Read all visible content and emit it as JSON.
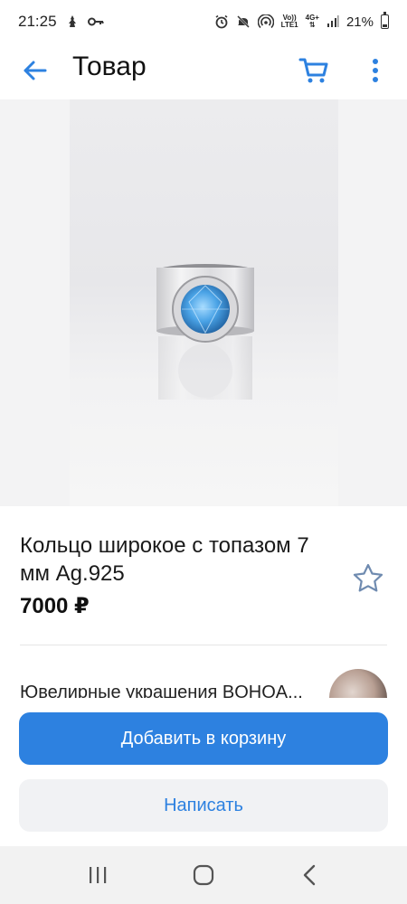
{
  "status_bar": {
    "time": "21:25",
    "battery_percent": "21%",
    "battery_level": 0.21,
    "network_top": "4G+",
    "network_bottom": "LTE1",
    "volte": "Vo))",
    "icons": [
      "notification-icon",
      "key-icon",
      "alarm-icon",
      "mute-icon",
      "hotspot-icon",
      "signal-icon",
      "battery-icon"
    ]
  },
  "app_bar": {
    "title": "Товар",
    "icons": [
      "back-arrow-icon",
      "cart-icon",
      "more-vert-icon"
    ],
    "accent": "#2d81e0"
  },
  "product": {
    "image_description": "silver wide ring with blue topaz",
    "title": "Кольцо широкое с топазом 7 мм Ag.925",
    "price": "7000 ₽",
    "favorite_icon": "star-outline-icon"
  },
  "seller": {
    "name": "Ювелирные украшения BOHOA..."
  },
  "actions": {
    "add_to_cart": "Добавить в корзину",
    "write": "Написать"
  },
  "nav": {
    "icons": [
      "recent-apps-icon",
      "home-icon",
      "back-icon"
    ]
  },
  "colors": {
    "primary": "#2d81e0",
    "secondary_button_bg": "#f1f2f4",
    "nav_bar_bg": "#f2f2f2"
  }
}
